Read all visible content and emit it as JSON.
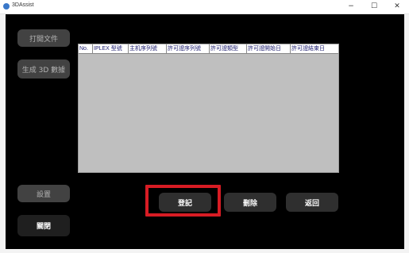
{
  "window": {
    "title": "3DAssist",
    "controls": {
      "minimize": "−",
      "maximize": "☐",
      "close": "✕"
    }
  },
  "sidebar": {
    "open_file": "打開文件",
    "generate_3d": "生成 3D 數據",
    "settings": "設置",
    "close": "關閉"
  },
  "table": {
    "columns": [
      "No.",
      "IPLEX 型號",
      "主机序列號",
      "許可證序列號",
      "許可證類型",
      "許可證開始日",
      "許可證結束日"
    ],
    "rows": []
  },
  "actions": {
    "register": "登記",
    "delete": "刪除",
    "back": "返回"
  },
  "colors": {
    "client_bg": "#000000",
    "table_bg": "#bfbfbf",
    "highlight": "#d81c24"
  }
}
